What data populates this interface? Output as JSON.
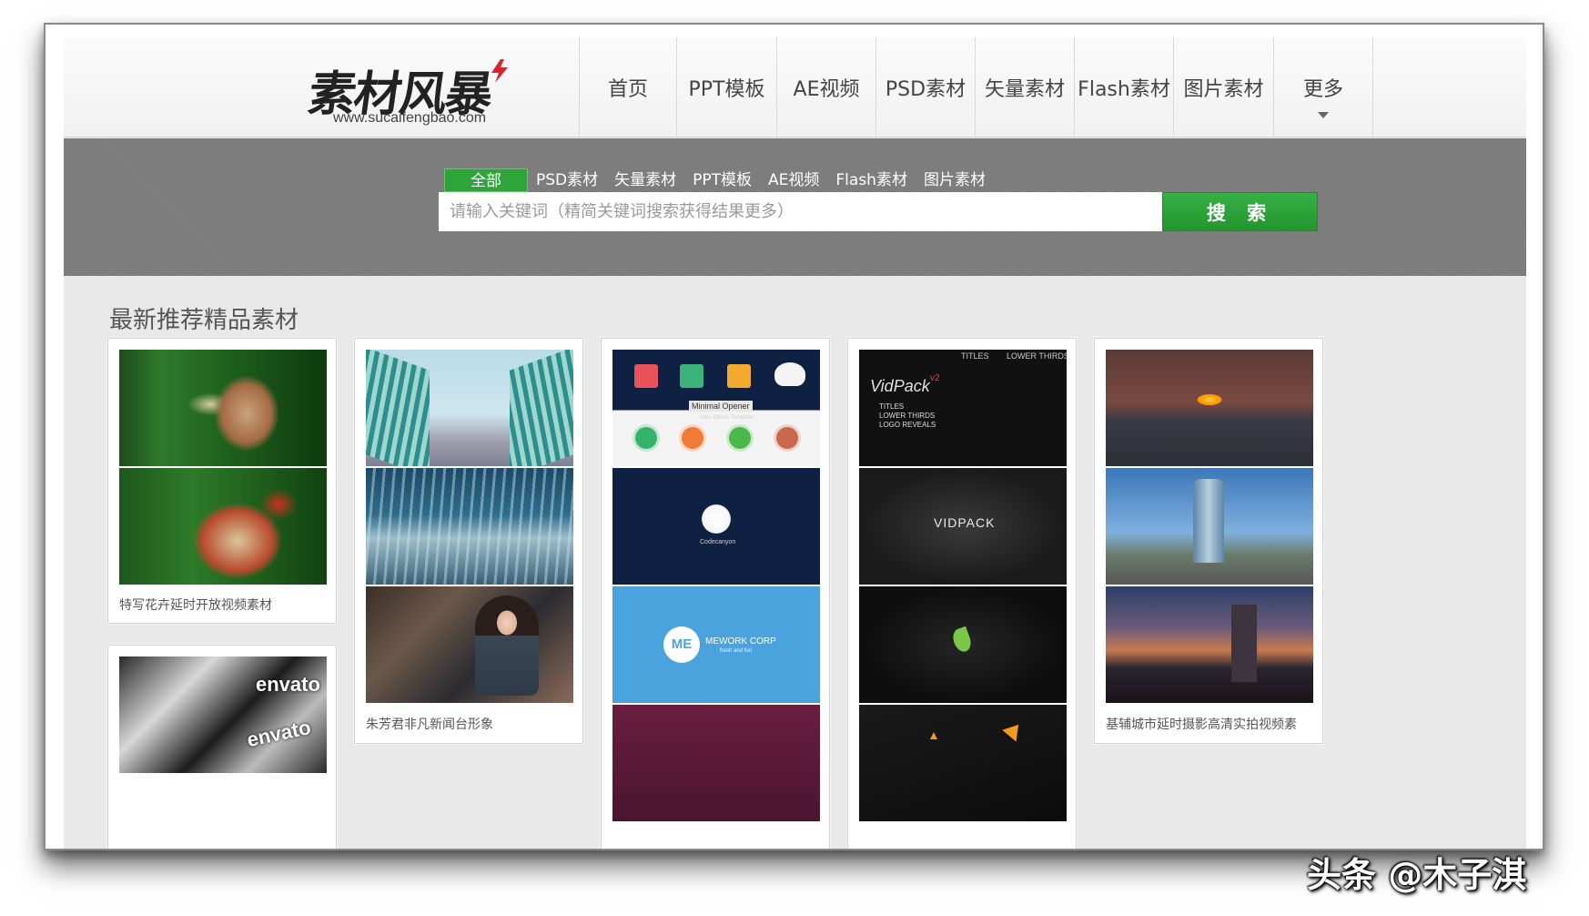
{
  "site": {
    "logo_text": "素材风暴",
    "logo_url": "www.sucaifengbao.com"
  },
  "nav": {
    "items": [
      {
        "label": "首页"
      },
      {
        "label": "PPT模板"
      },
      {
        "label": "AE视频"
      },
      {
        "label": "PSD素材"
      },
      {
        "label": "矢量素材"
      },
      {
        "label": "Flash素材"
      },
      {
        "label": "图片素材"
      },
      {
        "label": "更多"
      }
    ]
  },
  "search": {
    "tabs": [
      {
        "label": "全部",
        "active": true
      },
      {
        "label": "PSD素材"
      },
      {
        "label": "矢量素材"
      },
      {
        "label": "PPT模板"
      },
      {
        "label": "AE视频"
      },
      {
        "label": "Flash素材"
      },
      {
        "label": "图片素材"
      }
    ],
    "placeholder": "请输入关键词（精简关键词搜索获得结果更多）",
    "value": "",
    "button_label": "搜 索"
  },
  "section": {
    "title": "最新推荐精品素材"
  },
  "cards": [
    {
      "caption": "特写花卉延时开放视频素材"
    },
    {
      "caption": "朱芳君非凡新闻台形象"
    },
    {
      "caption": ""
    },
    {
      "caption": ""
    },
    {
      "caption": "基辅城市延时摄影高清实拍视频素"
    },
    {
      "caption": ""
    }
  ],
  "thumb_text": {
    "minimal_opener": "Minimal Opener",
    "after_effects_template": "After Effects Template",
    "codecanyon": "Codecanyon",
    "mework": "MEWORK CORP",
    "mework_sub": "fresh and fun",
    "me": "ME",
    "vidpack": "VidPack",
    "vidpack_ver": "v2",
    "titles": "TITLES",
    "lower_thirds": "LOWER THIRDS",
    "titles_list": "TITLES\nLOWER THIRDS\nLOGO REVEALS",
    "vidpack_caps": "VIDPACK",
    "envato": "envato"
  },
  "colors": {
    "accent_green": "#2ea43a",
    "search_band": "#7c7c7c",
    "page_bg": "#e9e9e9"
  },
  "watermark": "头条 @木子淇"
}
